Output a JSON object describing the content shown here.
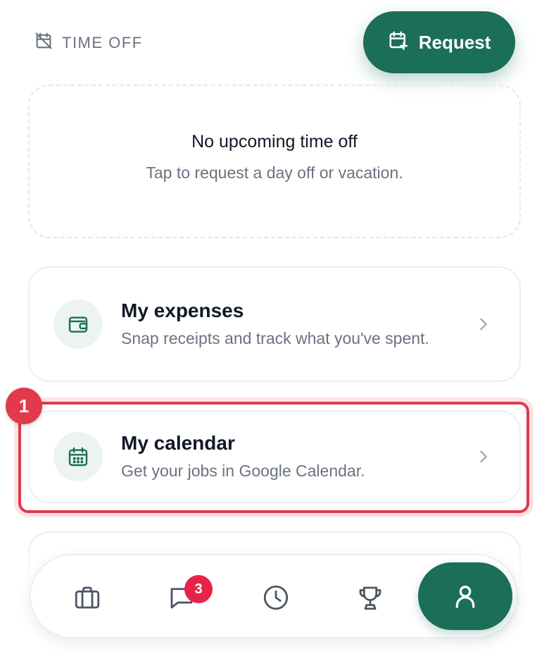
{
  "time_off": {
    "header_label": "TIME OFF",
    "header_icon": "calendar-off-icon",
    "request_label": "Request",
    "request_icon": "calendar-plus-icon",
    "empty_title": "No upcoming time off",
    "empty_subtitle": "Tap to request a day off or vacation."
  },
  "cards": [
    {
      "title": "My expenses",
      "subtitle": "Snap receipts and track what you've spent.",
      "icon": "wallet-icon"
    },
    {
      "title": "My calendar",
      "subtitle": "Get your jobs in Google Calendar.",
      "icon": "calendar-icon"
    }
  ],
  "annotation": {
    "step_number": "1",
    "color": "#e03a4b"
  },
  "bottom_nav": {
    "items": [
      {
        "icon": "briefcase-icon"
      },
      {
        "icon": "chat-icon",
        "badge": "3"
      },
      {
        "icon": "clock-icon"
      },
      {
        "icon": "trophy-icon"
      },
      {
        "icon": "user-icon",
        "active": true
      }
    ]
  },
  "colors": {
    "accent": "#1b6e58",
    "badge": "#e8234a",
    "muted_text": "#6b7280"
  }
}
